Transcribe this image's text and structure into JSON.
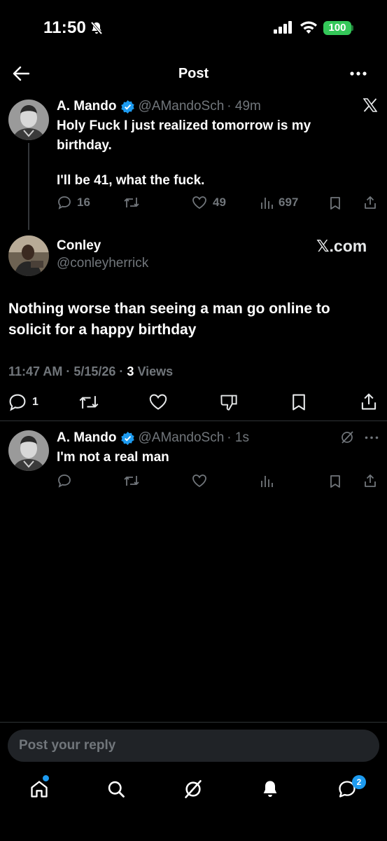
{
  "status_bar": {
    "time": "11:50",
    "battery": "100"
  },
  "header": {
    "title": "Post"
  },
  "original_tweet": {
    "name": "A. Mando",
    "handle": "@AMandoSch",
    "time": "· 49m",
    "lines": [
      "Holy Fuck I just realized tomorrow is my",
      "birthday.",
      "",
      "I'll be 41, what the fuck."
    ],
    "stats": {
      "replies": "16",
      "likes": "49",
      "views": "697"
    }
  },
  "quote_tweet": {
    "name": "Conley",
    "handle": "@conleyherrick",
    "watermark": "𝕏.com",
    "lines": [
      "Nothing worse than seeing a man go online to",
      "solicit for a happy birthday"
    ],
    "meta_time": "11:47 AM · 5/15/26 ·",
    "meta_views_count": "3",
    "meta_views_label": "Views",
    "stats": {
      "replies": "1"
    }
  },
  "reply_tweet": {
    "name": "A. Mando",
    "handle": "@AMandoSch",
    "time": "· 1s",
    "text": "I'm not a real man"
  },
  "composer": {
    "placeholder": "Post your reply"
  },
  "bottom_nav": {
    "messages_badge": "2"
  },
  "colors": {
    "accent": "#1d9bf0",
    "muted": "#71767b",
    "text": "#e7e9ea",
    "battery": "#34c759"
  }
}
